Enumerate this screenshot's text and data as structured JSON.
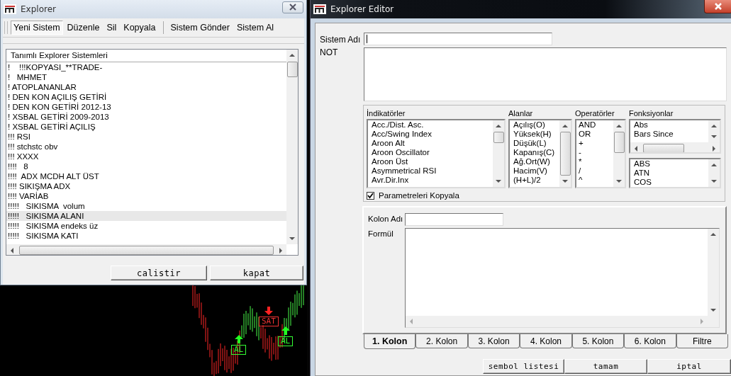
{
  "explorer_window": {
    "title": "Explorer",
    "toolbar": [
      {
        "items": [
          {
            "label": "Yeni Sistem",
            "selected": true
          },
          {
            "label": "Düzenle",
            "selected": false
          },
          {
            "label": "Sil",
            "selected": false
          },
          {
            "label": "Kopyala",
            "selected": false
          }
        ]
      },
      {
        "items": [
          {
            "label": "Sistem Gönder",
            "selected": false
          },
          {
            "label": "Sistem Al",
            "selected": false
          }
        ]
      }
    ],
    "list": {
      "header": "Tanımlı Explorer Sistemleri",
      "items": [
        {
          "label": "!    !!!KOPYASI_**TRADE-",
          "selected": false
        },
        {
          "label": "!   MHMET",
          "selected": false
        },
        {
          "label": "! ATOPLANANLAR",
          "selected": false
        },
        {
          "label": "! DEN KON AÇILIŞ GETİRİ",
          "selected": false
        },
        {
          "label": "! DEN KON GETİRİ 2012-13",
          "selected": false
        },
        {
          "label": "! XSBAL GETİRİ 2009-2013",
          "selected": false
        },
        {
          "label": "! XSBAL GETİRİ AÇILIŞ",
          "selected": false
        },
        {
          "label": "!!! RSI",
          "selected": false
        },
        {
          "label": "!!! stchstc obv",
          "selected": false
        },
        {
          "label": "!!! XXXX",
          "selected": false
        },
        {
          "label": "!!!!   8",
          "selected": false
        },
        {
          "label": "!!!!  ADX MCDH ALT ÜST",
          "selected": false
        },
        {
          "label": "!!!! SIKIŞMA ADX",
          "selected": false
        },
        {
          "label": "!!!! VARİAB",
          "selected": false
        },
        {
          "label": "!!!!!   SIKISMA  volum",
          "selected": false
        },
        {
          "label": "!!!!!   SIKISMA ALANI",
          "selected": true
        },
        {
          "label": "!!!!!   SIKISMA endeks üz",
          "selected": false
        },
        {
          "label": "!!!!!   SIKISMA KATI",
          "selected": false
        }
      ]
    },
    "buttons": [
      "calistir",
      "kapat"
    ]
  },
  "chart": {
    "signals": [
      {
        "kind": "buy",
        "label": "AL"
      },
      {
        "kind": "sell",
        "label": "SAT"
      },
      {
        "kind": "buy",
        "label": "AL"
      }
    ]
  },
  "editor_window": {
    "title": "Explorer Editor",
    "system_name": {
      "label": "Sistem Adı"
    },
    "note": {
      "label": "NOT"
    },
    "lists": [
      {
        "title": "İndikatörler",
        "items": [
          "Acc./Dist. Asc.",
          "Acc/Swing Index",
          "Aroon Alt",
          "Aroon Oscillator",
          "Aroon Üst",
          "Asymmetrical RSI",
          "Avr.Dir.Inx"
        ]
      },
      {
        "title": "Alanlar",
        "items": [
          "Açılış(O)",
          "Yüksek(H)",
          "Düşük(L)",
          "Kapanış(C)",
          "Ağ.Ort(W)",
          "Hacim(V)",
          "(H+L)/2"
        ]
      },
      {
        "title": "Operatörler",
        "items": [
          "AND",
          "OR",
          "+",
          "-",
          "*",
          "/",
          "^"
        ]
      },
      {
        "title": "Fonksiyonlar",
        "items": [
          "Abs",
          "Bars Since"
        ],
        "sub_items": [
          "ABS",
          "ATN",
          "COS"
        ]
      }
    ],
    "copy_parameters": {
      "label": "Parametreleri Kopyala",
      "checked": true
    },
    "column_name": {
      "label": "Kolon Adı"
    },
    "formula": {
      "label": "Formül"
    },
    "tabs": [
      {
        "label": "1. Kolon",
        "selected": true
      },
      {
        "label": "2. Kolon",
        "selected": false
      },
      {
        "label": "3. Kolon",
        "selected": false
      },
      {
        "label": "4. Kolon",
        "selected": false
      },
      {
        "label": "5. Kolon",
        "selected": false
      },
      {
        "label": "6. Kolon",
        "selected": false
      },
      {
        "label": "Filtre",
        "selected": false
      }
    ],
    "buttons": [
      "sembol listesi",
      "tamam",
      "iptal"
    ]
  }
}
